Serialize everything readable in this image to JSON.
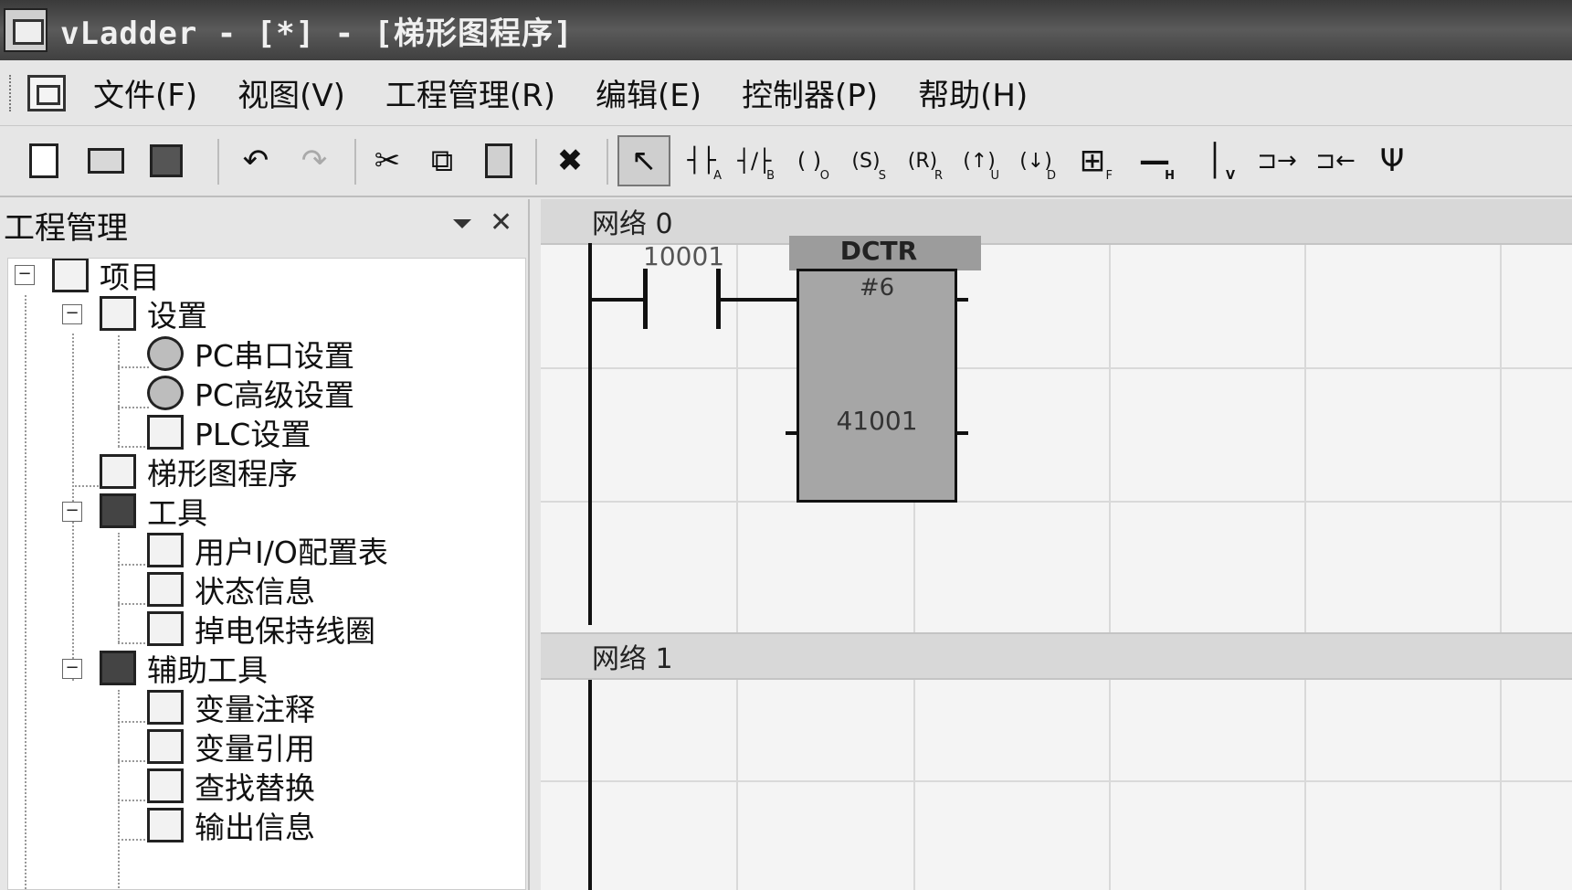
{
  "window": {
    "title": "vLadder - [*] - [梯形图程序]"
  },
  "menu": {
    "items": [
      "文件(F)",
      "视图(V)",
      "工程管理(R)",
      "编辑(E)",
      "控制器(P)",
      "帮助(H)"
    ]
  },
  "toolbar": {
    "buttons": [
      {
        "name": "new-icon",
        "glyph": ""
      },
      {
        "name": "open-icon",
        "glyph": ""
      },
      {
        "name": "save-all-icon",
        "glyph": ""
      },
      {
        "name": "undo-icon",
        "glyph": "↶"
      },
      {
        "name": "redo-icon",
        "glyph": "↷"
      },
      {
        "name": "cut-icon",
        "glyph": "✂"
      },
      {
        "name": "copy-icon",
        "glyph": "⧉"
      },
      {
        "name": "paste-icon",
        "glyph": ""
      },
      {
        "name": "delete-icon",
        "glyph": "✖"
      },
      {
        "name": "select-pointer-icon",
        "glyph": "↖"
      },
      {
        "name": "contact-no-icon",
        "glyph": "┤├",
        "sub": "A"
      },
      {
        "name": "contact-nc-icon",
        "glyph": "┤/├",
        "sub": "B"
      },
      {
        "name": "coil-icon",
        "glyph": "( )",
        "sub": "O"
      },
      {
        "name": "set-coil-icon",
        "glyph": "(S)",
        "sub": "S"
      },
      {
        "name": "reset-coil-icon",
        "glyph": "(R)",
        "sub": "R"
      },
      {
        "name": "up-coil-icon",
        "glyph": "(↑)",
        "sub": "U"
      },
      {
        "name": "down-coil-icon",
        "glyph": "(↓)",
        "sub": "D"
      },
      {
        "name": "function-block-icon",
        "glyph": "⊞",
        "sub": "F"
      },
      {
        "name": "horizontal-line-icon",
        "glyph": "—",
        "sub": "H"
      },
      {
        "name": "vertical-line-icon",
        "glyph": "│",
        "sub": "V"
      },
      {
        "name": "insert-branch-icon",
        "glyph": "⊐→"
      },
      {
        "name": "delete-branch-icon",
        "glyph": "⊐←"
      },
      {
        "name": "parallel-icon",
        "glyph": "Ψ"
      }
    ]
  },
  "panel": {
    "title": "工程管理",
    "tree": [
      {
        "label": "项目",
        "depth": 0,
        "expander": "−",
        "icon": "project-icon"
      },
      {
        "label": "设置",
        "depth": 1,
        "expander": "−",
        "icon": "settings-icon"
      },
      {
        "label": "PC串口设置",
        "depth": 2,
        "icon": "serial-port-icon"
      },
      {
        "label": "PC高级设置",
        "depth": 2,
        "icon": "advanced-settings-icon"
      },
      {
        "label": "PLC设置",
        "depth": 2,
        "icon": "plc-settings-icon"
      },
      {
        "label": "梯形图程序",
        "depth": 1,
        "icon": "ladder-program-icon"
      },
      {
        "label": "工具",
        "depth": 1,
        "expander": "−",
        "icon": "tools-icon"
      },
      {
        "label": "用户I/O配置表",
        "depth": 2,
        "icon": "io-table-icon"
      },
      {
        "label": "状态信息",
        "depth": 2,
        "icon": "status-icon"
      },
      {
        "label": "掉电保持线圈",
        "depth": 2,
        "icon": "retentive-coil-icon"
      },
      {
        "label": "辅助工具",
        "depth": 1,
        "expander": "−",
        "icon": "aux-tools-icon"
      },
      {
        "label": "变量注释",
        "depth": 2,
        "icon": "variable-comment-icon"
      },
      {
        "label": "变量引用",
        "depth": 2,
        "icon": "variable-reference-icon"
      },
      {
        "label": "查找替换",
        "depth": 2,
        "icon": "find-replace-icon"
      },
      {
        "label": "输出信息",
        "depth": 2,
        "icon": "output-info-icon"
      }
    ]
  },
  "ladder": {
    "networks": [
      {
        "label": "网络 0",
        "contact": {
          "address": "10001"
        },
        "block": {
          "name": "DCTR",
          "number": "#6",
          "register": "41001"
        }
      },
      {
        "label": "网络 1"
      }
    ]
  }
}
